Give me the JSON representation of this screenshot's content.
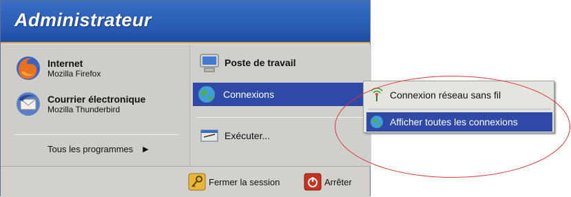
{
  "header": {
    "user_name": "Administrateur"
  },
  "pinned": [
    {
      "title": "Internet",
      "subtitle": "Mozilla Firefox",
      "icon": "firefox-icon"
    },
    {
      "title": "Courrier électronique",
      "subtitle": "Mozilla Thunderbird",
      "icon": "thunderbird-icon"
    }
  ],
  "all_programs": {
    "label": "Tous les programmes",
    "arrow": "▶"
  },
  "right": {
    "poste_de_travail": "Poste de travail",
    "connexions": "Connexions",
    "executer": "Exécuter..."
  },
  "submenu": {
    "items": [
      {
        "label": "Connexion réseau sans fil",
        "icon": "wireless-icon"
      },
      {
        "label": "Afficher toutes les connexions",
        "icon": "network-connections-icon"
      }
    ]
  },
  "footer": {
    "logoff": "Fermer la session",
    "shutdown": "Arrêter"
  },
  "colors": {
    "header_blue": "#2b5fb6",
    "highlight": "#2f4aa6",
    "annotation": "#e03030"
  }
}
